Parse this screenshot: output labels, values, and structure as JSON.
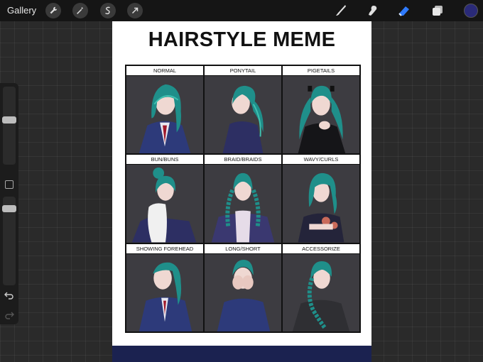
{
  "topbar": {
    "gallery_label": "Gallery",
    "left_tools": [
      "wrench-icon",
      "magic-wand-icon",
      "selection-icon",
      "transform-arrow-icon"
    ],
    "right_tools": [
      "brush-icon",
      "smudge-icon",
      "eraser-icon",
      "layers-icon"
    ],
    "active_color": "#2a2a78",
    "eraser_color": "#2f7bff"
  },
  "canvas": {
    "title": "HAIRSTYLE MEME",
    "cells": [
      {
        "label": "NORMAL"
      },
      {
        "label": "PONYTAIL"
      },
      {
        "label": "PIGETAILS"
      },
      {
        "label": "BUN/BUNS"
      },
      {
        "label": "BRAID/BRAIDS"
      },
      {
        "label": "WAVY/CURLS"
      },
      {
        "label": "SHOWING FOREHEAD"
      },
      {
        "label": "LONG/SHORT"
      },
      {
        "label": "ACCESSORIZE"
      }
    ],
    "hair_color": "#1f8f8a",
    "panel_bg": "#3d3c41",
    "bottom_band_color": "#1b2250"
  }
}
